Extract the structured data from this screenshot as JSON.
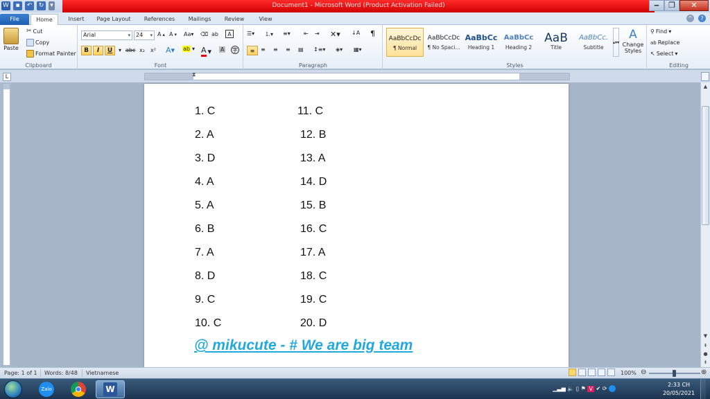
{
  "window": {
    "title": "Document1 - Microsoft Word (Product Activation Failed)",
    "minimize_icon": "minimize-icon",
    "maximize_icon": "restore-icon",
    "close_icon": "close-icon"
  },
  "tabs": [
    {
      "label": "File"
    },
    {
      "label": "Home"
    },
    {
      "label": "Insert"
    },
    {
      "label": "Page Layout"
    },
    {
      "label": "References"
    },
    {
      "label": "Mailings"
    },
    {
      "label": "Review"
    },
    {
      "label": "View"
    }
  ],
  "ribbon": {
    "clipboard": {
      "label": "Clipboard",
      "paste": "Paste",
      "cut": "Cut",
      "copy": "Copy",
      "format_painter": "Format Painter"
    },
    "font": {
      "label": "Font",
      "font_name": "Arial",
      "font_size": "24",
      "bold": "B",
      "italic": "I",
      "underline": "U"
    },
    "paragraph": {
      "label": "Paragraph"
    },
    "styles": {
      "label": "Styles",
      "items": [
        {
          "sample": "AaBbCcDc",
          "name": "¶ Normal"
        },
        {
          "sample": "AaBbCcDc",
          "name": "¶ No Spaci..."
        },
        {
          "sample": "AaBbCc",
          "name": "Heading 1"
        },
        {
          "sample": "AaBbCc",
          "name": "Heading 2"
        },
        {
          "sample": "AaB",
          "name": "Title"
        },
        {
          "sample": "AaBbCc.",
          "name": "Subtitle"
        }
      ],
      "change_styles": "Change Styles"
    },
    "editing": {
      "label": "Editing",
      "find": "Find",
      "replace": "Replace",
      "select": "Select"
    }
  },
  "document": {
    "left_column": [
      "1. C",
      "2. A",
      "3. D",
      "4. A",
      "5. A",
      "6. B",
      "7. A",
      "8. D",
      "9. C",
      "10. C"
    ],
    "right_column": [
      "11. C",
      "12. B",
      "13. A",
      "14. D",
      "15. B",
      "16. C",
      "17. A",
      "18. C",
      "19. C",
      "20. D"
    ],
    "footer": "@ mikucute - # We are big team"
  },
  "status": {
    "page": "Page: 1 of 1",
    "words": "Words: 8/48",
    "language": "Vietnamese",
    "zoom": "100%"
  },
  "taskbar": {
    "zalo_label": "Zalo",
    "clock_time": "2:33 CH",
    "clock_date": "20/05/2021"
  },
  "colors": {
    "title_bar": "#e00000",
    "ribbon_bg": "#e6eef8",
    "link_blue": "#21a8dc",
    "file_tab": "#2a6cc4"
  }
}
